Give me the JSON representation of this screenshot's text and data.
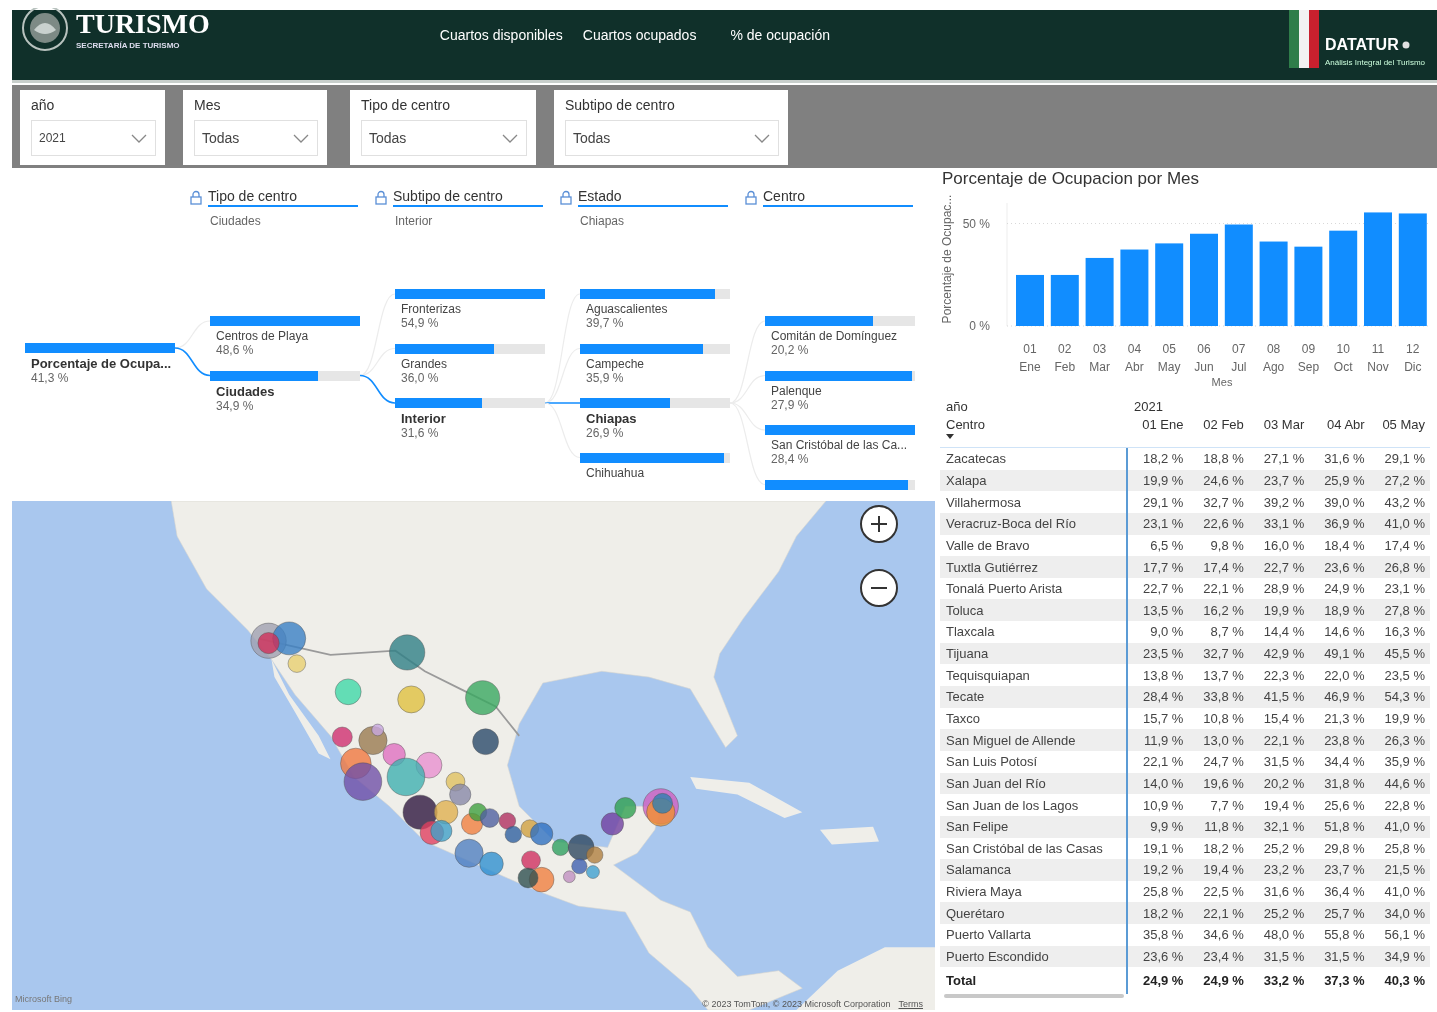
{
  "header": {
    "logo_title": "TURISMO",
    "logo_subtitle": "SECRETARÍA DE TURISMO",
    "nav": [
      {
        "label": "Cuartos disponibles"
      },
      {
        "label": "Cuartos ocupados"
      },
      {
        "label": "% de ocupación"
      }
    ],
    "brand": {
      "name": "DATATUR",
      "subtitle": "Análisis Integral del Turismo"
    }
  },
  "filters": [
    {
      "label": "año",
      "value": "2021"
    },
    {
      "label": "Mes",
      "value": "Todas"
    },
    {
      "label": "Tipo de centro",
      "value": "Todas"
    },
    {
      "label": "Subtipo de centro",
      "value": "Todas"
    }
  ],
  "decomposition_tree": {
    "root": {
      "label": "Porcentaje de Ocupa...",
      "value": "41,3 %",
      "level": 1
    },
    "levels": [
      {
        "header": "Tipo de centro",
        "selection": "Ciudades",
        "nodes": [
          {
            "label": "Centros de Playa",
            "value": "48,6 %",
            "level": 1,
            "selected": false
          },
          {
            "label": "Ciudades",
            "value": "34,9 %",
            "level": 0.72,
            "selected": true
          }
        ]
      },
      {
        "header": "Subtipo de centro",
        "selection": "Interior",
        "nodes": [
          {
            "label": "Fronterizas",
            "value": "54,9 %",
            "level": 1,
            "selected": false
          },
          {
            "label": "Grandes",
            "value": "36,0 %",
            "level": 0.66,
            "selected": false
          },
          {
            "label": "Interior",
            "value": "31,6 %",
            "level": 0.58,
            "selected": true
          }
        ]
      },
      {
        "header": "Estado",
        "selection": "Chiapas",
        "nodes": [
          {
            "label": "Aguascalientes",
            "value": "39,7 %",
            "level": 0.9,
            "selected": false
          },
          {
            "label": "Campeche",
            "value": "35,9 %",
            "level": 0.82,
            "selected": false
          },
          {
            "label": "Chiapas",
            "value": "26,9 %",
            "level": 0.6,
            "selected": true
          },
          {
            "label": "Chihuahua",
            "level": 0.96,
            "selected": false
          }
        ]
      },
      {
        "header": "Centro",
        "nodes": [
          {
            "label": "Comitán de Domínguez",
            "value": "20,2 %",
            "level": 0.72,
            "selected": false
          },
          {
            "label": "Palenque",
            "value": "27,9 %",
            "level": 0.98,
            "selected": false
          },
          {
            "label": "San Cristóbal de las Ca...",
            "value": "28,4 %",
            "level": 1,
            "selected": false
          },
          {
            "level": 0.95,
            "selected": false
          }
        ]
      }
    ]
  },
  "chart": {
    "chart_data": {
      "type": "bar",
      "title": "Porcentaje de Ocupacion por Mes",
      "xlabel": "Mes",
      "ylabel": "Porcentaje de Ocupac...",
      "categories": [
        "01 Ene",
        "02 Feb",
        "03 Mar",
        "04 Abr",
        "05 May",
        "06 Jun",
        "07 Jul",
        "08 Ago",
        "09 Sep",
        "10 Oct",
        "11 Nov",
        "12 Dic"
      ],
      "series": [
        {
          "color": "#118dff",
          "values": [
            24.9,
            24.9,
            33.2,
            37.3,
            40.3,
            45,
            49.5,
            41.2,
            38.7,
            46.5,
            55.4,
            54.9
          ]
        }
      ],
      "ylim": [
        0,
        60
      ],
      "yticks": [
        {
          "value": 0,
          "label": "0 %"
        },
        {
          "value": 50,
          "label": "50 %"
        }
      ]
    }
  },
  "table": {
    "year_label": "año",
    "year": "2021",
    "row_header": "Centro",
    "columns": [
      "01 Ene",
      "02 Feb",
      "03 Mar",
      "04 Abr",
      "05 May"
    ],
    "rows": [
      {
        "name": "Zacatecas",
        "values": [
          "18,2 %",
          "18,8 %",
          "27,1 %",
          "31,6 %",
          "29,1 %"
        ]
      },
      {
        "name": "Xalapa",
        "values": [
          "19,9 %",
          "24,6 %",
          "23,7 %",
          "25,9 %",
          "27,2 %"
        ]
      },
      {
        "name": "Villahermosa",
        "values": [
          "29,1 %",
          "32,7 %",
          "39,2 %",
          "39,0 %",
          "43,2 %"
        ]
      },
      {
        "name": "Veracruz-Boca del Río",
        "values": [
          "23,1 %",
          "22,6 %",
          "33,1 %",
          "36,9 %",
          "41,0 %"
        ]
      },
      {
        "name": "Valle de Bravo",
        "values": [
          "6,5 %",
          "9,8 %",
          "16,0 %",
          "18,4 %",
          "17,4 %"
        ]
      },
      {
        "name": "Tuxtla Gutiérrez",
        "values": [
          "17,7 %",
          "17,4 %",
          "22,7 %",
          "23,6 %",
          "26,8 %"
        ]
      },
      {
        "name": "Tonalá Puerto Arista",
        "values": [
          "22,7 %",
          "22,1 %",
          "28,9 %",
          "24,9 %",
          "23,1 %"
        ]
      },
      {
        "name": "Toluca",
        "values": [
          "13,5 %",
          "16,2 %",
          "19,9 %",
          "18,9 %",
          "27,8 %"
        ]
      },
      {
        "name": "Tlaxcala",
        "values": [
          "9,0 %",
          "8,7 %",
          "14,4 %",
          "14,6 %",
          "16,3 %"
        ]
      },
      {
        "name": "Tijuana",
        "values": [
          "23,5 %",
          "32,7 %",
          "42,9 %",
          "49,1 %",
          "45,5 %"
        ]
      },
      {
        "name": "Tequisquiapan",
        "values": [
          "13,8 %",
          "13,7 %",
          "22,3 %",
          "22,0 %",
          "23,5 %"
        ]
      },
      {
        "name": "Tecate",
        "values": [
          "28,4 %",
          "33,8 %",
          "41,5 %",
          "46,9 %",
          "54,3 %"
        ]
      },
      {
        "name": "Taxco",
        "values": [
          "15,7 %",
          "10,8 %",
          "15,4 %",
          "21,3 %",
          "19,9 %"
        ]
      },
      {
        "name": "San Miguel de Allende",
        "values": [
          "11,9 %",
          "13,0 %",
          "22,1 %",
          "23,8 %",
          "26,3 %"
        ]
      },
      {
        "name": "San Luis Potosí",
        "values": [
          "22,1 %",
          "24,7 %",
          "31,5 %",
          "34,4 %",
          "35,9 %"
        ]
      },
      {
        "name": "San Juan del Río",
        "values": [
          "14,0 %",
          "19,6 %",
          "20,2 %",
          "31,8 %",
          "44,6 %"
        ]
      },
      {
        "name": "San Juan de los Lagos",
        "values": [
          "10,9 %",
          "7,7 %",
          "19,4 %",
          "25,6 %",
          "22,8 %"
        ]
      },
      {
        "name": "San Felipe",
        "values": [
          "9,9 %",
          "11,8 %",
          "32,1 %",
          "51,8 %",
          "41,0 %"
        ]
      },
      {
        "name": "San Cristóbal de las Casas",
        "values": [
          "19,1 %",
          "18,2 %",
          "25,2 %",
          "29,8 %",
          "25,8 %"
        ]
      },
      {
        "name": "Salamanca",
        "values": [
          "19,2 %",
          "19,4 %",
          "23,2 %",
          "23,7 %",
          "21,5 %"
        ]
      },
      {
        "name": "Riviera Maya",
        "values": [
          "25,8 %",
          "22,5 %",
          "31,6 %",
          "36,4 %",
          "41,0 %"
        ]
      },
      {
        "name": "Querétaro",
        "values": [
          "18,2 %",
          "22,1 %",
          "25,2 %",
          "25,7 %",
          "34,0 %"
        ]
      },
      {
        "name": "Puerto Vallarta",
        "values": [
          "35,8 %",
          "34,6 %",
          "48,0 %",
          "55,8 %",
          "56,1 %"
        ]
      },
      {
        "name": "Puerto Escondido",
        "values": [
          "23,6 %",
          "23,4 %",
          "31,5 %",
          "31,5 %",
          "34,9 %"
        ]
      }
    ],
    "total": {
      "name": "Total",
      "values": [
        "24,9 %",
        "24,9 %",
        "33,2 %",
        "37,3 %",
        "40,3 %"
      ]
    }
  },
  "map": {
    "provider": "Microsoft Bing",
    "attribution": "© 2023 TomTom, © 2023 Microsoft Corporation",
    "terms_link": "Terms"
  }
}
